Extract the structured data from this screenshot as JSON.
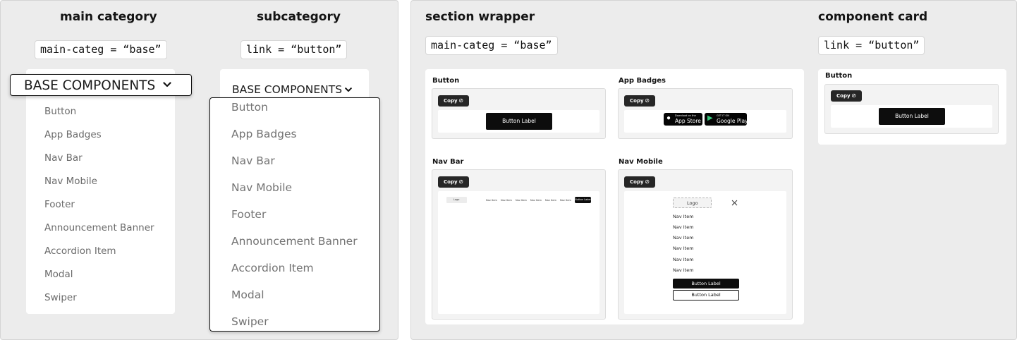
{
  "left_panel": {
    "main_heading": "main category",
    "sub_heading": "subcategory",
    "main_code": "main-categ = “base”",
    "sub_code": "link = “button”",
    "dropdown_label": "BASE COMPONENTS",
    "items": [
      "Button",
      "App Badges",
      "Nav Bar",
      "Nav Mobile",
      "Footer",
      "Announcement Banner",
      "Accordion Item",
      "Modal",
      "Swiper"
    ]
  },
  "right_panel": {
    "section_heading": "section wrapper",
    "card_heading": "component card",
    "section_code": "main-categ = “base”",
    "card_code": "link = “button”",
    "copy_label": "Copy",
    "cards": {
      "button": {
        "title": "Button",
        "button_label": "Button Label"
      },
      "app_badges": {
        "title": "App Badges",
        "appstore_small": "Download on the",
        "appstore_big": "App Store",
        "googleplay_small": "GET IT ON",
        "googleplay_big": "Google Play"
      },
      "nav_bar": {
        "title": "Nav Bar",
        "logo": "Logo",
        "items": [
          "Nav Item",
          "Nav Item",
          "Nav Item",
          "Nav Item",
          "Nav Item",
          "Nav Item"
        ],
        "button_label": "Button Label"
      },
      "nav_mobile": {
        "title": "Nav Mobile",
        "logo": "Logo",
        "items": [
          "Nav Item",
          "Nav Item",
          "Nav Item",
          "Nav Item",
          "Nav Item",
          "Nav Item"
        ],
        "primary_button": "Button Label",
        "secondary_button": "Button Label"
      },
      "component_card": {
        "title": "Button",
        "button_label": "Button Label"
      }
    }
  }
}
